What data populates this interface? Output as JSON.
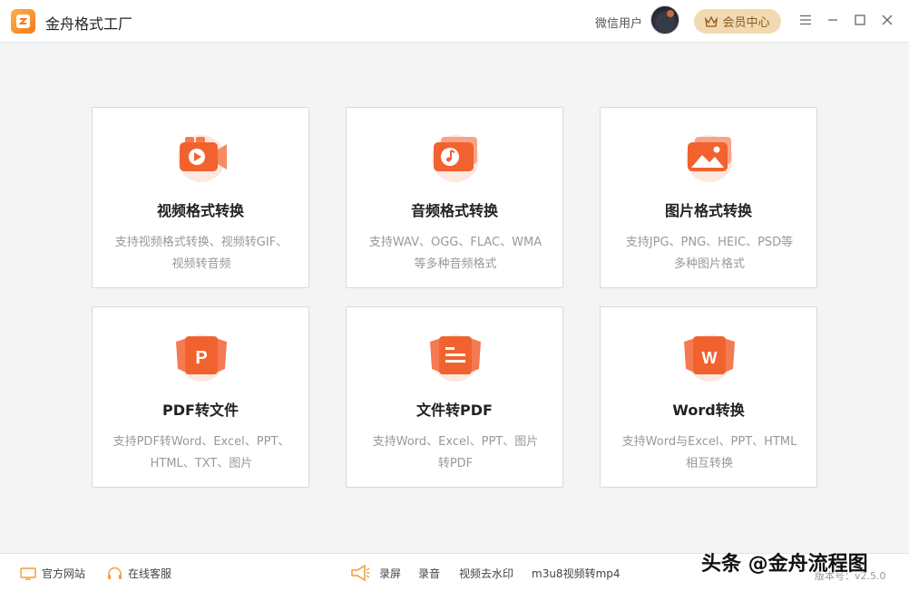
{
  "app": {
    "title": "金舟格式工厂",
    "user_name": "微信用户",
    "vip_label": "会员中心"
  },
  "cards": [
    {
      "title": "视频格式转换",
      "desc_line1": "支持视频格式转换、视频转GIF、",
      "desc_line2": "视频转音频",
      "icon": "video-icon"
    },
    {
      "title": "音频格式转换",
      "desc_line1": "支持WAV、OGG、FLAC、WMA",
      "desc_line2": "等多种音频格式",
      "icon": "audio-icon"
    },
    {
      "title": "图片格式转换",
      "desc_line1": "支持JPG、PNG、HEIC、PSD等",
      "desc_line2": "多种图片格式",
      "icon": "image-icon"
    },
    {
      "title": "PDF转文件",
      "desc_line1": "支持PDF转Word、Excel、PPT、",
      "desc_line2": "HTML、TXT、图片",
      "icon": "pdf-icon",
      "icon_letter": "P"
    },
    {
      "title": "文件转PDF",
      "desc_line1": "支持Word、Excel、PPT、图片",
      "desc_line2": "转PDF",
      "icon": "document-icon"
    },
    {
      "title": "Word转换",
      "desc_line1": "支持Word与Excel、PPT、HTML",
      "desc_line2": "相互转换",
      "icon": "word-icon",
      "icon_letter": "W"
    }
  ],
  "footer": {
    "website": "官方网站",
    "support": "在线客服",
    "record_screen": "录屏",
    "record_audio": "录音",
    "remove_watermark": "视频去水印",
    "m3u8": "m3u8视频转mp4",
    "version": "版本号：v2.5.0"
  },
  "watermark": "头条 @金舟流程图",
  "colors": {
    "accent": "#f2622e",
    "vip_bg": "#f3d9b1",
    "vip_text": "#8a5a1c"
  }
}
